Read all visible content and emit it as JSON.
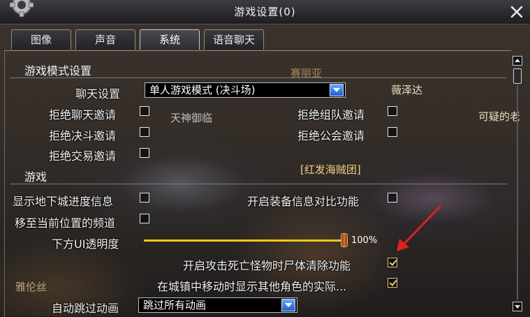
{
  "window": {
    "title": "游戏设置(0)"
  },
  "tabs": [
    {
      "label": "图像",
      "active": false
    },
    {
      "label": "声音",
      "active": false
    },
    {
      "label": "系统",
      "active": true
    },
    {
      "label": "语音聊天",
      "active": false
    }
  ],
  "sections": {
    "game_mode": "游戏模式设置",
    "game": "游戏"
  },
  "settings": {
    "chat_setting_label": "聊天设置",
    "chat_setting_value": "单人游戏模式 (决斗场)",
    "reject_chat_invite": {
      "label": "拒绝聊天邀请",
      "checked": false
    },
    "reject_party_invite": {
      "label": "拒绝组队邀请",
      "checked": false
    },
    "reject_duel_invite": {
      "label": "拒绝决斗邀请",
      "checked": false
    },
    "reject_guild_invite": {
      "label": "拒绝公会邀请",
      "checked": false
    },
    "reject_trade_invite": {
      "label": "拒绝交易邀请",
      "checked": false
    },
    "show_dungeon_progress": {
      "label": "显示地下城进度信息",
      "checked": false
    },
    "equip_compare": {
      "label": "开启装备信息对比功能",
      "checked": false
    },
    "move_to_channel": {
      "label": "移至当前位置的频道",
      "checked": false
    },
    "ui_opacity_label": "下方UI透明度",
    "ui_opacity_value": "100%",
    "ui_opacity_fraction": 1.0,
    "corpse_clear": {
      "label": "开启攻击死亡怪物时尸体清除功能",
      "checked": true
    },
    "town_show_others": {
      "label": "在城镇中移动时显示其他角色的实际...",
      "checked": true
    },
    "auto_skip_label": "自动跳过动画",
    "auto_skip_value": "跳过所有动画"
  },
  "scene_labels": {
    "npc1": "赛丽亚",
    "npc2": "薇泽达",
    "npc3": "天神御临",
    "npc4": "可疑的老",
    "npc5": "[红发海贼团]",
    "npc6": "雅伦丝"
  },
  "colors": {
    "accent_yellow": "#f2c81a",
    "dropdown_blue": "#2f7ae8",
    "annotation_red": "#e02020"
  }
}
